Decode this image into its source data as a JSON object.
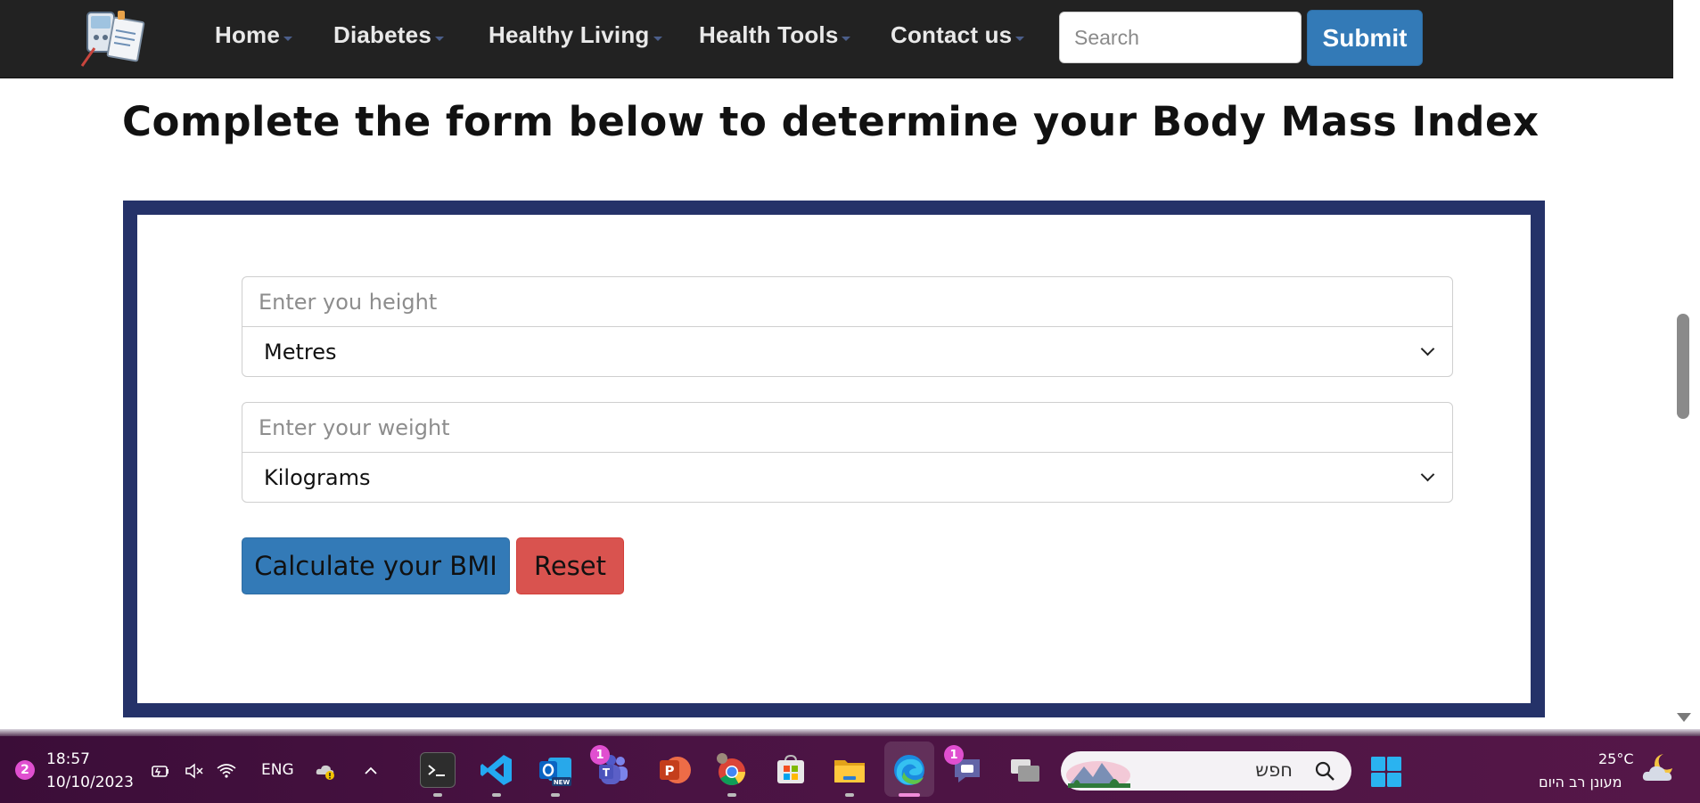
{
  "navbar": {
    "items": [
      {
        "label": "Home"
      },
      {
        "label": "Diabetes"
      },
      {
        "label": "Healthy Living"
      },
      {
        "label": "Health Tools"
      },
      {
        "label": "Contact us"
      }
    ],
    "search_placeholder": "Search",
    "submit_label": "Submit"
  },
  "main": {
    "heading": "Complete the form below to determine your Body Mass Index",
    "height_placeholder": "Enter you height",
    "height_unit": "Metres",
    "weight_placeholder": "Enter your weight",
    "weight_unit": "Kilograms",
    "calculate_label": "Calculate your BMI",
    "reset_label": "Reset"
  },
  "colors": {
    "navbar_bg": "#222222",
    "frame_border": "#253269",
    "primary_button": "#337ab7",
    "danger_button": "#d9534f",
    "taskbar_bg": "#4a1343"
  },
  "taskbar": {
    "notification_count": "2",
    "time": "18:57",
    "date": "10/10/2023",
    "language": "ENG",
    "apps": [
      {
        "name": "terminal-icon"
      },
      {
        "name": "vscode-icon"
      },
      {
        "name": "outlook-new-icon",
        "badge_text": "NEW"
      },
      {
        "name": "teams-icon",
        "badge": "1"
      },
      {
        "name": "powerpoint-icon"
      },
      {
        "name": "chrome-icon"
      },
      {
        "name": "microsoft-store-icon"
      },
      {
        "name": "file-explorer-icon"
      },
      {
        "name": "edge-icon"
      },
      {
        "name": "chat-icon",
        "badge": "1"
      },
      {
        "name": "task-view-icon"
      }
    ],
    "search_text": "חפש",
    "weather_temp": "25°C",
    "weather_desc": "מעונן רב היום"
  }
}
